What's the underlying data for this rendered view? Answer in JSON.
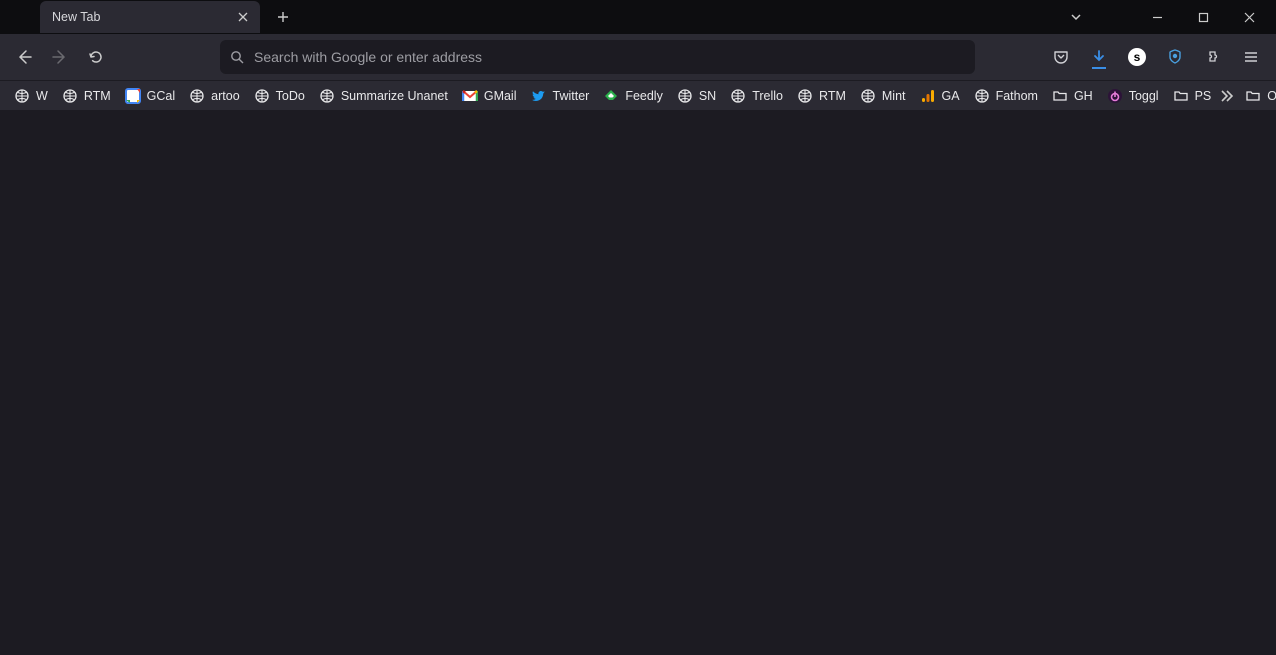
{
  "tab": {
    "title": "New Tab"
  },
  "urlbar": {
    "placeholder": "Search with Google or enter address"
  },
  "bookmarks": [
    {
      "label": "W",
      "icon": "globe"
    },
    {
      "label": "RTM",
      "icon": "globe"
    },
    {
      "label": "GCal",
      "icon": "gcal"
    },
    {
      "label": "artoo",
      "icon": "globe"
    },
    {
      "label": "ToDo",
      "icon": "globe"
    },
    {
      "label": "Summarize Unanet",
      "icon": "globe"
    },
    {
      "label": "GMail",
      "icon": "gmail"
    },
    {
      "label": "Twitter",
      "icon": "twitter"
    },
    {
      "label": "Feedly",
      "icon": "feedly"
    },
    {
      "label": "SN",
      "icon": "globe"
    },
    {
      "label": "Trello",
      "icon": "globe"
    },
    {
      "label": "RTM",
      "icon": "globe"
    },
    {
      "label": "Mint",
      "icon": "globe"
    },
    {
      "label": "GA",
      "icon": "ga"
    },
    {
      "label": "Fathom",
      "icon": "globe"
    },
    {
      "label": "GH",
      "icon": "folder"
    },
    {
      "label": "Toggl",
      "icon": "toggl"
    },
    {
      "label": "PS",
      "icon": "folder"
    }
  ],
  "other_bookmarks_label": "Other Bookmarks"
}
